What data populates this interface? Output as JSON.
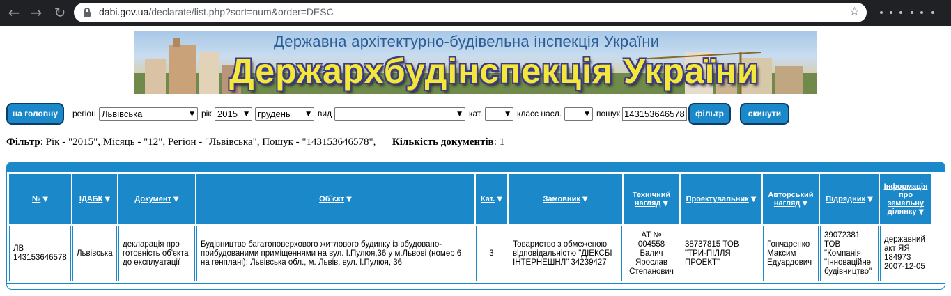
{
  "browser": {
    "url_host": "dabi.gov.ua",
    "url_path": "/declarate/list.php?sort=num&order=DESC"
  },
  "banner": {
    "subtitle": "Державна архітектурно-будівельна інспекція України",
    "title": "Держархбудінспекція України"
  },
  "filters": {
    "home_button": "на головну",
    "region_label": "регіон",
    "region_value": "Львівська",
    "year_label": "рік",
    "year_value": "2015",
    "month_value": "грудень",
    "kind_label": "вид",
    "kind_value": "",
    "cat_label": "кат.",
    "cat_value": "",
    "class_label": "класс насл.",
    "class_value": "",
    "search_label": "пошук",
    "search_value": "143153646578",
    "filter_button": "фільтр",
    "reset_button": "скинути"
  },
  "summary": {
    "filter_label": "Фільтр",
    "filter_text": ": Рік - \"2015\", Місяць - \"12\", Регіон - \"Львівська\", Пошук - \"143153646578\",",
    "count_label": "Кількість документів",
    "count_value": ": 1"
  },
  "table": {
    "headers": [
      "№",
      "ІДАБК",
      "Документ",
      "Об`єкт",
      "Кат.",
      "Замовник",
      "Технічний нагляд",
      "Проектувальник",
      "Авторський нагляд",
      "Підрядник",
      "Інформація про земельну ділянку"
    ],
    "rows": [
      {
        "num": "ЛВ 143153646578",
        "idabk": "Львівська",
        "document": "декларація про готовність об'єкта до експлуатації",
        "object": "Будівництво багатоповерхового житлового будинку із вбудовано-прибудованими приміщеннями на вул. І.Пулюя,36 у м.Львові (номер 6 на генплані); Львівська обл., м. Львів, вул. І.Пулюя, 36",
        "cat": "3",
        "customer": "Товариство з обмеженою відповідальністю \"ДІЕКСБІ ІНТЕРНЕШНЛ\" 34239427",
        "tech_supervision": "АТ № 004558 Балич Ярослав Степанович",
        "designer": "38737815 ТОВ \"ТРИ-ПІЛЛЯ ПРОЕКТ\"",
        "author_supervision": "Гончаренко Максим Едуардович",
        "contractor": "39072381 ТОВ \"Компанія \"Інноваційне будівництво\"",
        "land_info": "державний акт ЯЯ 184973 2007-12-05"
      }
    ]
  }
}
